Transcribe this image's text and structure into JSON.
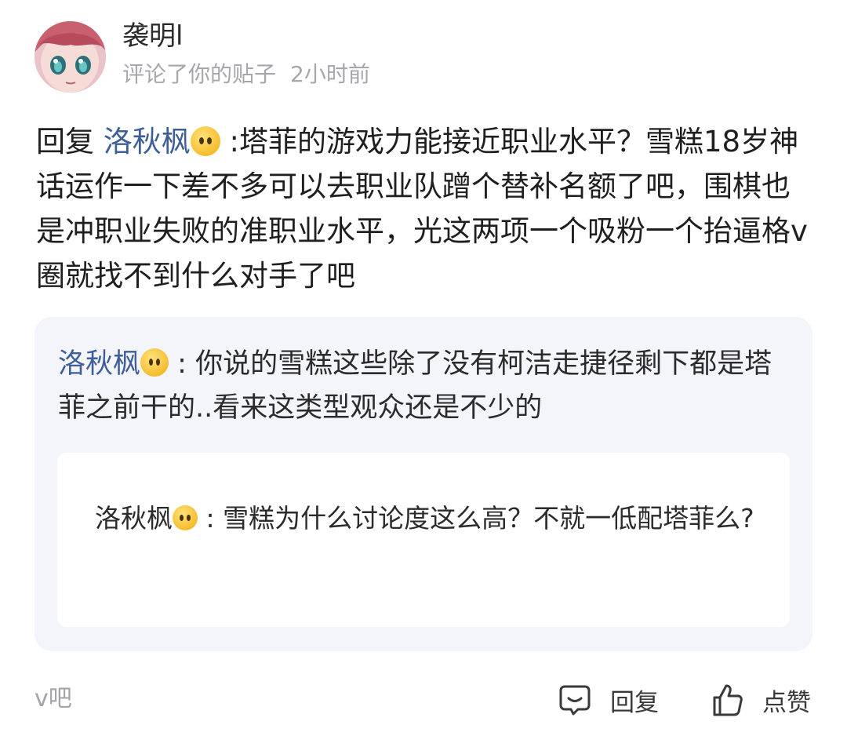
{
  "header": {
    "username": "袭明l",
    "action_text": "评论了你的贴子",
    "time": "2小时前",
    "avatar_icon": "anime-avatar"
  },
  "reply": {
    "prefix": "回复 ",
    "mention": "洛秋枫",
    "emoji": "expressionless-emoji",
    "separator": " :",
    "text": "塔菲的游戏力能接近职业水平？雪糕18岁神话运作一下差不多可以去职业队蹭个替补名额了吧，围棋也是冲职业失败的准职业水平，光这两项一个吸粉一个抬逼格v圈就找不到什么对手了吧"
  },
  "quote": {
    "mention": "洛秋枫",
    "separator": " : ",
    "text": "你说的雪糕这些除了没有柯洁走捷径剩下都是塔菲之前干的..看来这类型观众还是不少的",
    "nested": {
      "mention": "洛秋枫",
      "separator": " : ",
      "text": "雪糕为什么讨论度这么高？不就一低配塔菲么?"
    }
  },
  "footer": {
    "forum": "v吧",
    "reply_label": "回复",
    "like_label": "点赞",
    "reply_icon": "comment-bubble-icon",
    "like_icon": "thumbs-up-icon"
  },
  "colors": {
    "mention": "#3d5e98",
    "meta": "#a6a6ad",
    "quote_bg": "#f4f4fb"
  }
}
